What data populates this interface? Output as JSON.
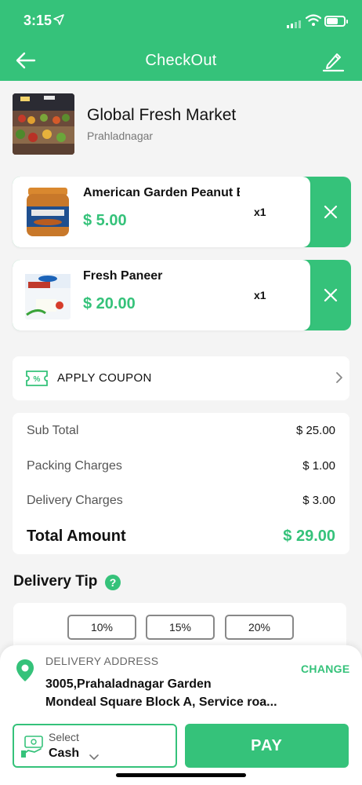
{
  "status_bar": {
    "time": "3:15"
  },
  "header": {
    "title": "CheckOut"
  },
  "store": {
    "name": "Global Fresh Market",
    "area": "Prahladnagar"
  },
  "cart_items": [
    {
      "name": "American Garden Peanut Butter",
      "price": "$ 5.00",
      "qty": "x1"
    },
    {
      "name": "Fresh Paneer",
      "price": "$ 20.00",
      "qty": "x1"
    }
  ],
  "coupon": {
    "label": "APPLY COUPON"
  },
  "summary": {
    "subtotal_label": "Sub Total",
    "subtotal": "$ 25.00",
    "packing_label": "Packing Charges",
    "packing": "$ 1.00",
    "delivery_label": "Delivery Charges",
    "delivery": "$ 3.00",
    "total_label": "Total Amount",
    "total": "$ 29.00"
  },
  "tip": {
    "title": "Delivery Tip",
    "help": "?",
    "options": [
      "10%",
      "15%",
      "20%"
    ]
  },
  "address": {
    "label": "DELIVERY ADDRESS",
    "change": "CHANGE",
    "line1": "3005,Prahaladnagar Garden",
    "line2": "Mondeal Square Block A, Service roa..."
  },
  "payment": {
    "select_label": "Select",
    "method": "Cash",
    "pay_label": "PAY"
  },
  "colors": {
    "accent": "#35c27a"
  }
}
